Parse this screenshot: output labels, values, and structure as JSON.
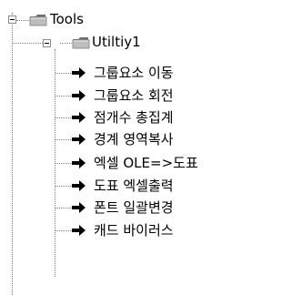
{
  "tree": {
    "root": {
      "label": "Tools",
      "icon": "folder-icon",
      "expanded": true
    },
    "group": {
      "label": "Utiltiy1",
      "icon": "folder-icon",
      "expanded": true
    },
    "items": [
      {
        "label": "그룹요소 이동",
        "icon": "arrow-right-icon"
      },
      {
        "label": "그룹요소 회전",
        "icon": "arrow-right-icon"
      },
      {
        "label": "점개수 총집계",
        "icon": "arrow-right-icon"
      },
      {
        "label": "경계 영역복사",
        "icon": "arrow-right-icon"
      },
      {
        "label": "엑셀 OLE=>도표",
        "icon": "arrow-right-icon"
      },
      {
        "label": "도표 엑셀출력",
        "icon": "arrow-right-icon"
      },
      {
        "label": "폰트 일괄변경",
        "icon": "arrow-right-icon"
      },
      {
        "label": "캐드 바이러스",
        "icon": "arrow-right-icon"
      }
    ],
    "colors": {
      "connector": "#808080",
      "folder_tab": "#6f6f6f",
      "folder_body": "#bdbdbd",
      "folder_shadow": "#8f8f8f",
      "arrow": "#000000"
    }
  }
}
